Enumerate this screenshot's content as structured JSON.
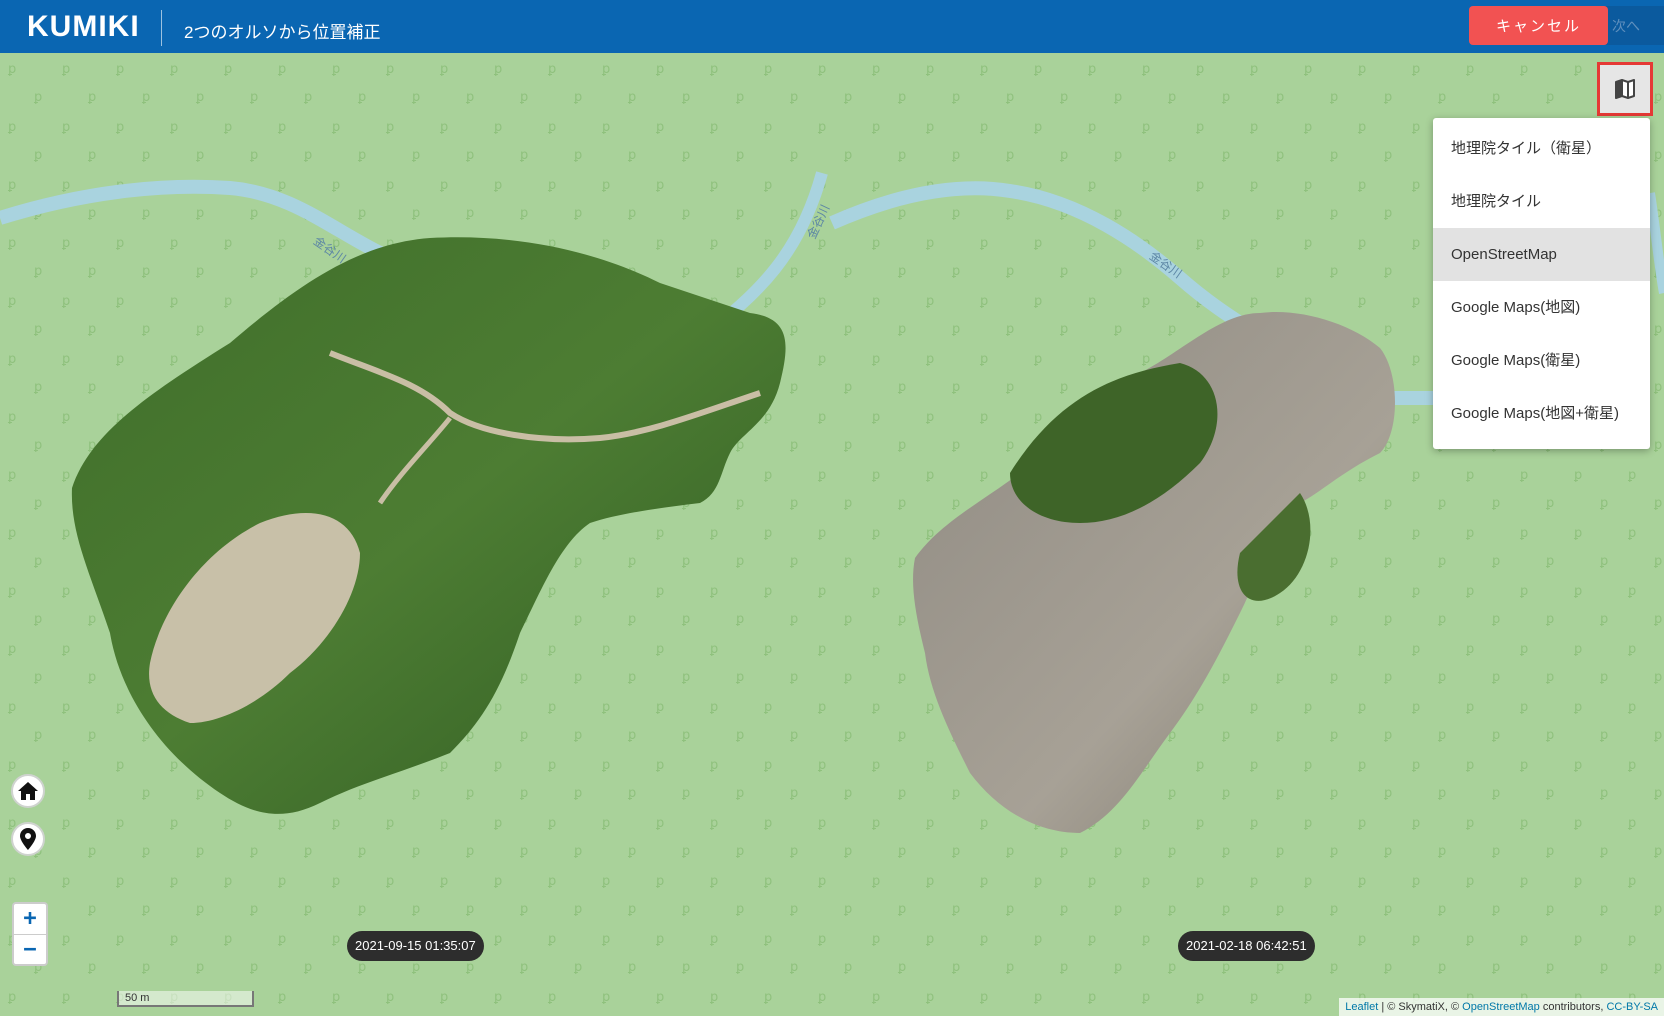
{
  "header": {
    "logo": "KUMIKI",
    "title": "2つのオルソから位置補正",
    "cancel_label": "キャンセル",
    "next_label": "次へ",
    "color": "#0a66b2"
  },
  "map": {
    "river_label_1": "金谷川",
    "river_label_2": "金谷川",
    "river_label_3": "金谷川",
    "ortho_left_time": "2021-09-15 01:35:07",
    "ortho_right_time": "2021-02-18 06:42:51",
    "scale": "50 m",
    "attribution": {
      "leaflet": "Leaflet",
      "skymatix": " | © SkymatiX, © ",
      "osm": "OpenStreetMap",
      "contributors": " contributors, ",
      "license": "CC-BY-SA"
    },
    "zoom_in": "+",
    "zoom_out": "−"
  },
  "controls": {
    "home_icon": "home-icon",
    "location_icon": "map-marker-icon",
    "layer_icon": "map-icon"
  },
  "layers": {
    "items": [
      {
        "label": "地理院タイル（衛星）",
        "active": false
      },
      {
        "label": "地理院タイル",
        "active": false
      },
      {
        "label": "OpenStreetMap",
        "active": true
      },
      {
        "label": "Google Maps(地図)",
        "active": false
      },
      {
        "label": "Google Maps(衛星)",
        "active": false
      },
      {
        "label": "Google Maps(地図+衛星)",
        "active": false
      }
    ]
  }
}
